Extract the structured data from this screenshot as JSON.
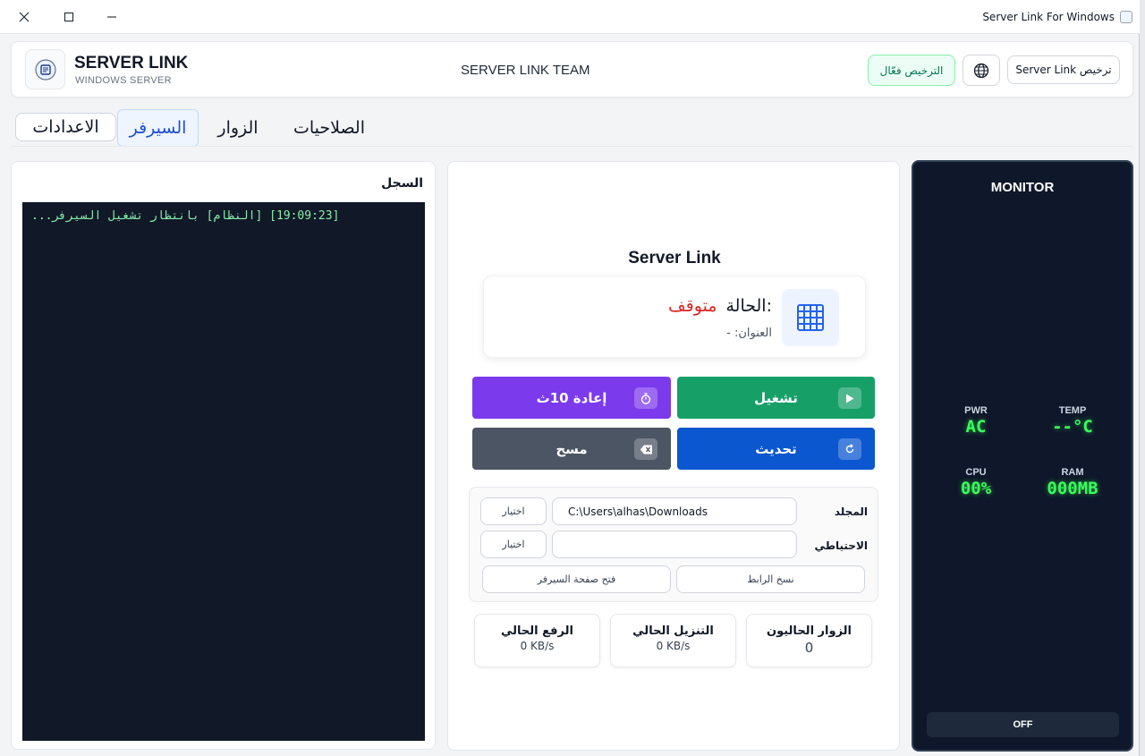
{
  "titlebar": {
    "title": "Server Link For Windows",
    "close_icon": "close-icon",
    "maximize_icon": "maximize-icon",
    "minimize_icon": "minimize-icon"
  },
  "header": {
    "brand_title": "SERVER LINK",
    "brand_subtitle": "WINDOWS SERVER",
    "team": "SERVER LINK TEAM",
    "license_active": "الترخيص فعّال",
    "license_button": "Server Link ترخيص"
  },
  "tabs": {
    "settings": "الاعدادات",
    "server": "السيرفر",
    "visitors": "الزوار",
    "permissions": "الصلاحيات",
    "active": "server"
  },
  "log": {
    "title": "السجل",
    "lines": [
      "[19:09:23] [النظام] بانتظار تشغيل السيرفر..."
    ]
  },
  "server": {
    "title": "Server Link",
    "status_label": "الحالة:",
    "status_value": "متوقف",
    "address_text": "- :العنوان",
    "buttons": {
      "restart": "إعادة 10ث",
      "start": "تشغيل",
      "clear": "مسح",
      "refresh": "تحديث"
    },
    "folder_label": "المجلد",
    "folder_value": "C:\\Users\\alhas\\Downloads",
    "backup_label": "الاحتياطي",
    "backup_value": "",
    "choose_label": "اختيار",
    "open_page": "فتح صفحة السيرفر",
    "copy_link": "نسخ الرابط",
    "stats": {
      "upload_label": "الرفع الحالي",
      "upload_value": "0 KB/s",
      "download_label": "التنزيل الحالي",
      "download_value": "0 KB/s",
      "visitors_label": "الزوار الحاليون",
      "visitors_value": "0"
    }
  },
  "monitor": {
    "title": "MONITOR",
    "pwr_label": "PWR",
    "pwr_value": "AC",
    "temp_label": "TEMP",
    "temp_value": "--°C",
    "cpu_label": "CPU",
    "cpu_value": "00%",
    "ram_label": "RAM",
    "ram_value": "000MB",
    "toggle": "OFF"
  },
  "colors": {
    "accent_blue": "#1d4ed8",
    "status_stopped": "#dc2626",
    "restart": "#7c3aed",
    "start": "#16a068",
    "clear": "#4b5563",
    "refresh": "#0b57d0",
    "monitor_bg": "#0f172a",
    "monitor_value": "#39ff5a"
  }
}
